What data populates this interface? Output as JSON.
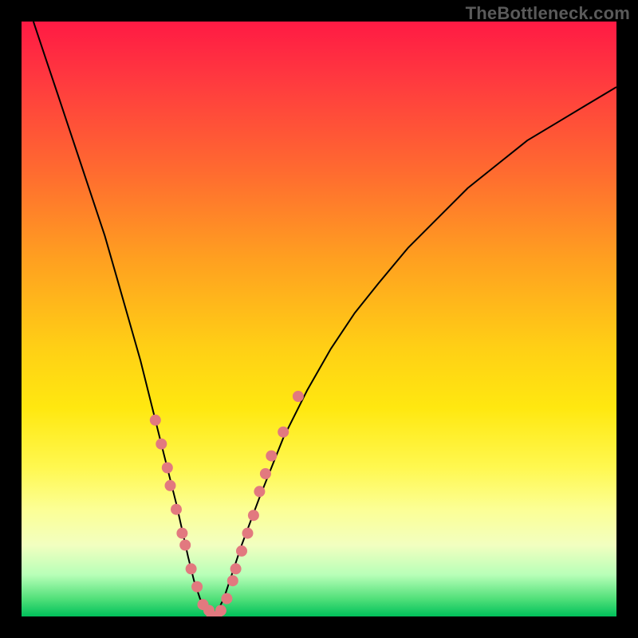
{
  "watermark": "TheBottleneck.com",
  "chart_data": {
    "type": "line",
    "title": "",
    "xlabel": "",
    "ylabel": "",
    "xlim": [
      0,
      100
    ],
    "ylim": [
      0,
      100
    ],
    "grid": false,
    "series": [
      {
        "name": "bottleneck-curve",
        "x": [
          2,
          4,
          6,
          8,
          10,
          12,
          14,
          16,
          18,
          20,
          22,
          24,
          26,
          28,
          29,
          30,
          31,
          32,
          33,
          34,
          35,
          37,
          40,
          44,
          48,
          52,
          56,
          60,
          65,
          70,
          75,
          80,
          85,
          90,
          95,
          100
        ],
        "y": [
          100,
          94,
          88,
          82,
          76,
          70,
          64,
          57,
          50,
          43,
          35,
          27,
          19,
          10,
          6,
          3,
          1,
          0,
          1,
          3,
          6,
          12,
          20,
          30,
          38,
          45,
          51,
          56,
          62,
          67,
          72,
          76,
          80,
          83,
          86,
          89
        ],
        "color": "#000000"
      }
    ],
    "markers": {
      "name": "highlighted-points",
      "color": "#e2797f",
      "points": [
        {
          "x": 22.5,
          "y": 33
        },
        {
          "x": 23.5,
          "y": 29
        },
        {
          "x": 24.5,
          "y": 25
        },
        {
          "x": 25.0,
          "y": 22
        },
        {
          "x": 26.0,
          "y": 18
        },
        {
          "x": 27.0,
          "y": 14
        },
        {
          "x": 27.5,
          "y": 12
        },
        {
          "x": 28.5,
          "y": 8
        },
        {
          "x": 29.5,
          "y": 5
        },
        {
          "x": 30.5,
          "y": 2
        },
        {
          "x": 31.5,
          "y": 1
        },
        {
          "x": 32.0,
          "y": 0
        },
        {
          "x": 32.8,
          "y": 0
        },
        {
          "x": 33.5,
          "y": 1
        },
        {
          "x": 34.5,
          "y": 3
        },
        {
          "x": 35.5,
          "y": 6
        },
        {
          "x": 36.0,
          "y": 8
        },
        {
          "x": 37.0,
          "y": 11
        },
        {
          "x": 38.0,
          "y": 14
        },
        {
          "x": 39.0,
          "y": 17
        },
        {
          "x": 40.0,
          "y": 21
        },
        {
          "x": 41.0,
          "y": 24
        },
        {
          "x": 42.0,
          "y": 27
        },
        {
          "x": 44.0,
          "y": 31
        },
        {
          "x": 46.5,
          "y": 37
        }
      ]
    }
  }
}
